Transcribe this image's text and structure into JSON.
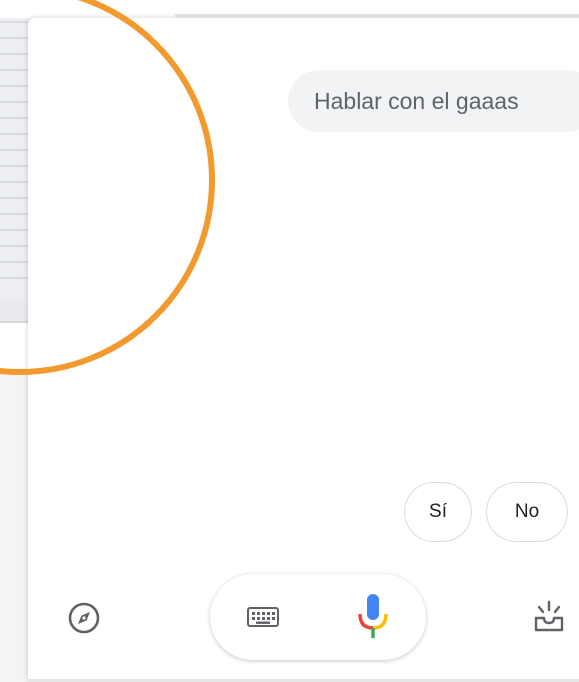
{
  "conversation": {
    "user_query": "Hablar con el gaaas"
  },
  "suggestions": [
    {
      "label": "Sí"
    },
    {
      "label": "No"
    }
  ],
  "bottom_bar": {
    "explore_icon": "compass-icon",
    "keyboard_icon": "keyboard-icon",
    "mic_icon": "microphone-icon",
    "snapshot_icon": "snapshot-inbox-icon"
  },
  "colors": {
    "highlight_circle": "#f29a2e",
    "bubble_bg": "#f1f3f4",
    "mic_blue": "#4285f4",
    "mic_red": "#ea4335",
    "mic_yellow": "#fbbc05",
    "mic_green": "#34a853"
  }
}
